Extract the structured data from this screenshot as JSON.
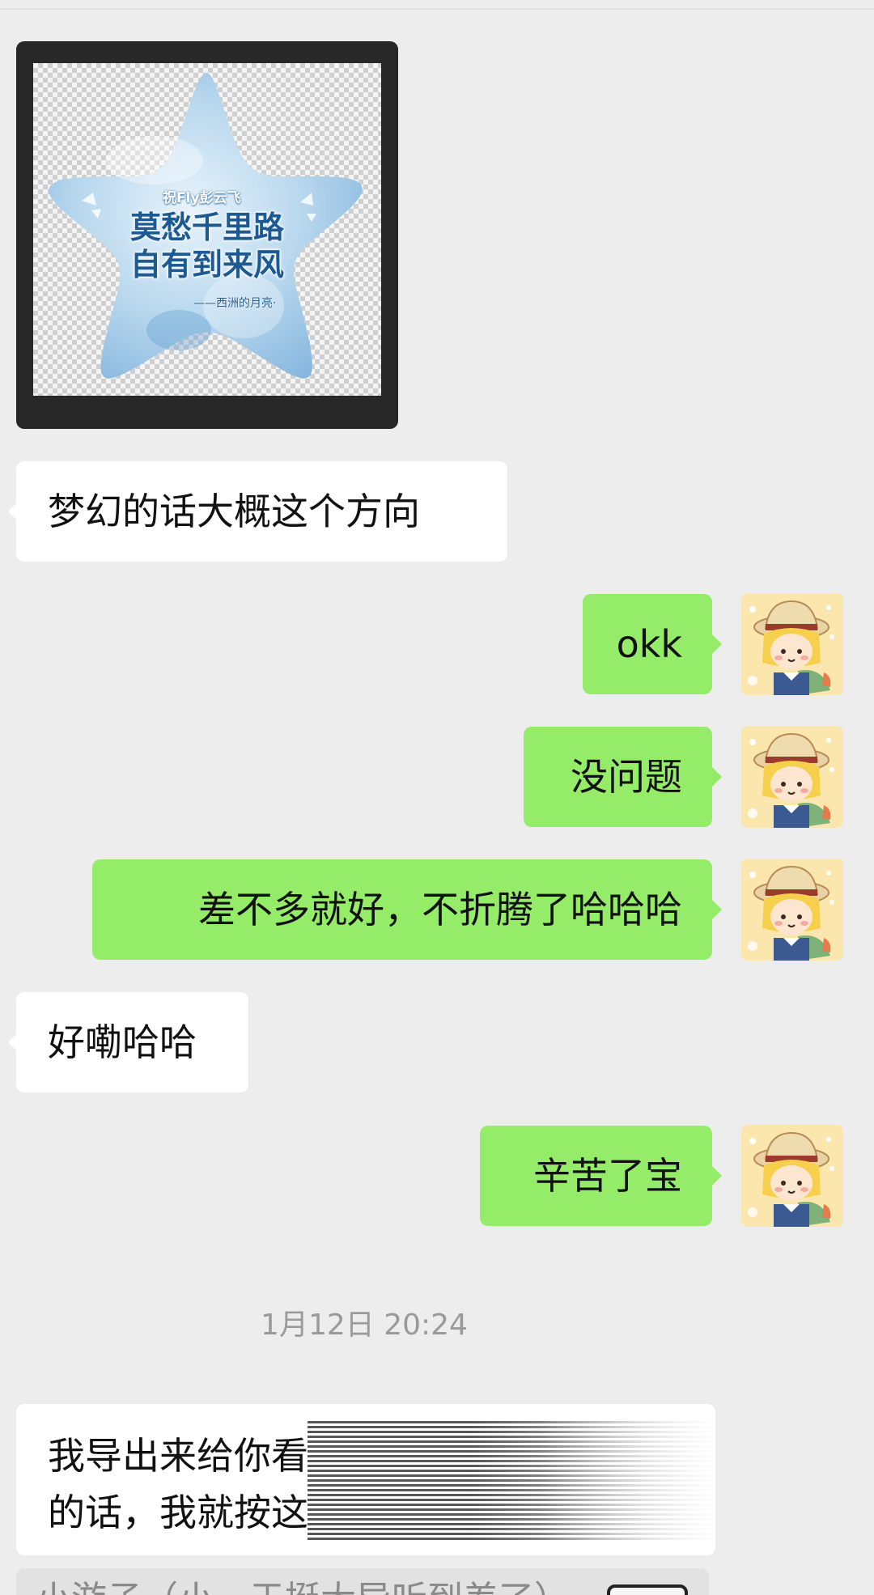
{
  "image_message": {
    "small_text": "祝Fly彭云飞",
    "main_line1": "莫愁千里路",
    "main_line2": "自有到来风",
    "signature": "——西洲的月亮·"
  },
  "messages": [
    {
      "side": "left",
      "text": "梦幻的话大概这个方向"
    },
    {
      "side": "right",
      "text": "okk"
    },
    {
      "side": "right",
      "text": "没问题"
    },
    {
      "side": "right",
      "text": "差不多就好，不折腾了哈哈哈"
    },
    {
      "side": "left",
      "text": "好嘞哈哈"
    },
    {
      "side": "right",
      "text": "辛苦了宝"
    }
  ],
  "timestamp": "1月12日 20:24",
  "long_message": {
    "line1": "我导出来给你看",
    "line2": "的话，我就按这"
  },
  "bottom_peek": {
    "text": "小游子（小，于挺大导听到差了）"
  },
  "colors": {
    "background": "#ededed",
    "received_bubble": "#ffffff",
    "sent_bubble": "#95ec69",
    "timestamp": "#9a9a9a"
  },
  "icons": {
    "avatar": "cartoon-girl-straw-hat-avatar"
  }
}
